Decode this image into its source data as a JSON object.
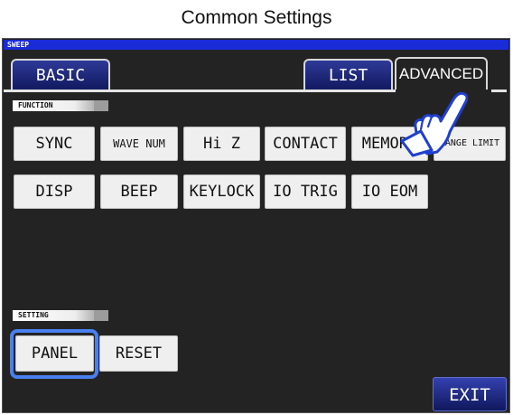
{
  "window_title": "Common Settings",
  "breadcrumb": "SWEEP",
  "tabs": {
    "basic": "BASIC",
    "list": "LIST",
    "advanced": "ADVANCED"
  },
  "function_section": {
    "label": "FUNCTION",
    "buttons_row1": [
      "SYNC",
      "WAVE NUM",
      "Hi Z",
      "CONTACT",
      "MEMORY",
      "RANGE LIMIT"
    ],
    "buttons_row2": [
      "DISP",
      "BEEP",
      "KEYLOCK",
      "IO TRIG",
      "IO EOM"
    ]
  },
  "setting_section": {
    "label": "SETTING",
    "panel": "PANEL",
    "reset": "RESET"
  },
  "exit": "EXIT",
  "icons": {
    "pointer": "hand-pointer-icon"
  }
}
